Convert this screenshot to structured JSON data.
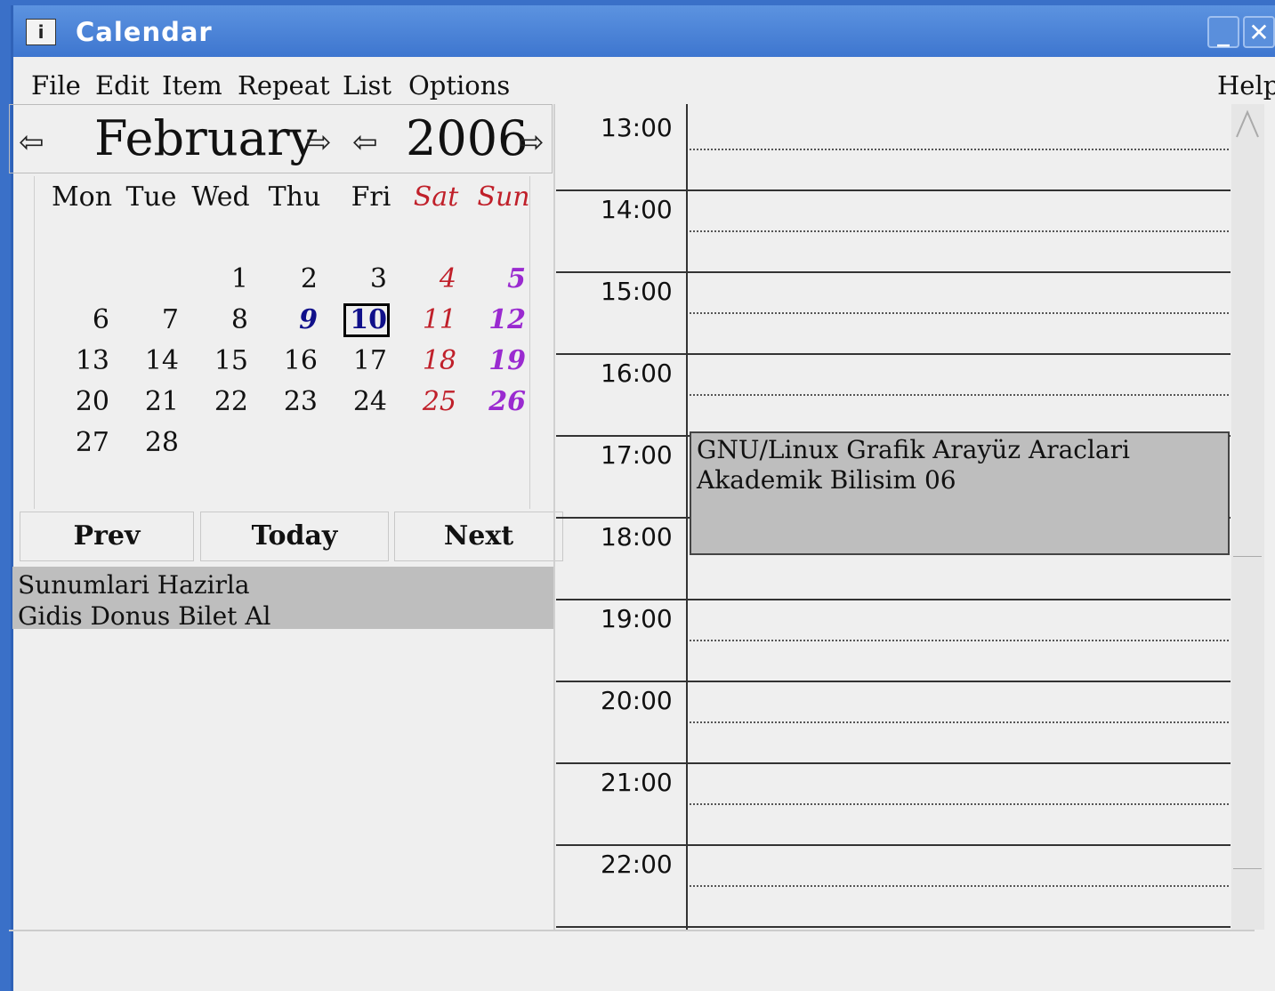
{
  "window": {
    "title": "Calendar",
    "minimize_label": "_",
    "close_label": "✕"
  },
  "app_icon_glyph": "i",
  "menu": {
    "file": "File",
    "edit": "Edit",
    "item": "Item",
    "repeat": "Repeat",
    "list": "List",
    "options": "Options",
    "help": "Help"
  },
  "month_nav": {
    "month": "February",
    "year": "2006",
    "prev_glyph": "⇦",
    "next_glyph": "⇨"
  },
  "weekdays": [
    "Mon",
    "Tue",
    "Wed",
    "Thu",
    "Fri",
    "Sat",
    "Sun"
  ],
  "days": [
    "1",
    "2",
    "3",
    "4",
    "5",
    "6",
    "7",
    "8",
    "9",
    "10",
    "11",
    "12",
    "13",
    "14",
    "15",
    "16",
    "17",
    "18",
    "19",
    "20",
    "21",
    "22",
    "23",
    "24",
    "25",
    "26",
    "27",
    "28"
  ],
  "selected_day": "10",
  "buttons": {
    "prev": "Prev",
    "today": "Today",
    "next": "Next"
  },
  "todos": [
    "Sunumlari Hazirla",
    "Gidis Donus Bilet Al"
  ],
  "hours": [
    "13:00",
    "14:00",
    "15:00",
    "16:00",
    "17:00",
    "18:00",
    "19:00",
    "20:00",
    "21:00",
    "22:00"
  ],
  "event": {
    "title": "GNU/Linux Grafik Arayüz Araclari",
    "subtitle": "Akademik Bilisim 06",
    "start": "17:00"
  },
  "colors": {
    "titlebar": "#4a82d6",
    "saturday": "#c0202a",
    "sunday": "#9a2ad0",
    "highlight_day": "#10108a",
    "event_bg": "#bebebe"
  }
}
